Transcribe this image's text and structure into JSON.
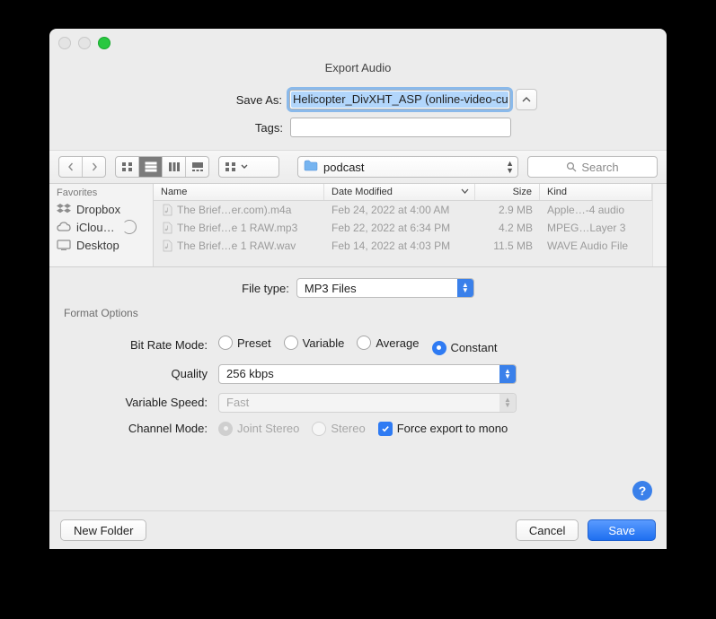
{
  "title": "Export Audio",
  "saveAs": {
    "label": "Save As:",
    "value": "Helicopter_DivXHT_ASP (online-video-cu"
  },
  "tags": {
    "label": "Tags:",
    "value": ""
  },
  "location": {
    "folder": "podcast"
  },
  "search": {
    "placeholder": "Search"
  },
  "sidebar": {
    "header": "Favorites",
    "items": [
      {
        "label": "Dropbox"
      },
      {
        "label": "iClou…"
      },
      {
        "label": "Desktop"
      }
    ]
  },
  "columns": {
    "name": "Name",
    "date": "Date Modified",
    "size": "Size",
    "kind": "Kind"
  },
  "files": [
    {
      "name": "The Brief…er.com).m4a",
      "date": "Feb 24, 2022 at 4:00 AM",
      "size": "2.9 MB",
      "kind": "Apple…-4 audio"
    },
    {
      "name": "The Brief…e 1 RAW.mp3",
      "date": "Feb 22, 2022 at 6:34 PM",
      "size": "4.2 MB",
      "kind": "MPEG…Layer 3"
    },
    {
      "name": "The Brief…e 1 RAW.wav",
      "date": "Feb 14, 2022 at 4:03 PM",
      "size": "11.5 MB",
      "kind": "WAVE Audio File"
    }
  ],
  "fileType": {
    "label": "File type:",
    "value": "MP3 Files"
  },
  "format": {
    "title": "Format Options",
    "bitRateMode": {
      "label": "Bit Rate Mode:",
      "options": [
        "Preset",
        "Variable",
        "Average",
        "Constant"
      ],
      "selected": "Constant"
    },
    "quality": {
      "label": "Quality",
      "value": "256 kbps"
    },
    "variableSpeed": {
      "label": "Variable Speed:",
      "value": "Fast",
      "disabled": true
    },
    "channelMode": {
      "label": "Channel Mode:",
      "options": [
        {
          "label": "Joint Stereo",
          "checked": true,
          "disabled": true
        },
        {
          "label": "Stereo",
          "checked": false,
          "disabled": true
        }
      ],
      "forceMono": "Force export to mono",
      "forceMonoChecked": true
    }
  },
  "help": "?",
  "buttons": {
    "newFolder": "New Folder",
    "cancel": "Cancel",
    "save": "Save"
  }
}
